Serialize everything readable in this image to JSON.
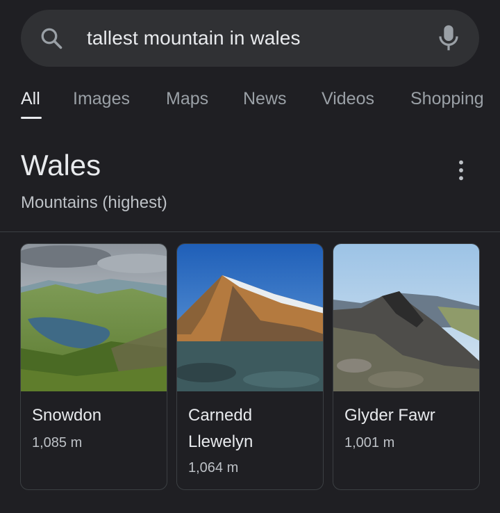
{
  "search": {
    "query": "tallest mountain in wales",
    "icon": "search-icon",
    "mic_icon": "mic-icon"
  },
  "tabs": [
    {
      "label": "All",
      "active": true
    },
    {
      "label": "Images",
      "active": false
    },
    {
      "label": "Maps",
      "active": false
    },
    {
      "label": "News",
      "active": false
    },
    {
      "label": "Videos",
      "active": false
    },
    {
      "label": "Shopping",
      "active": false
    }
  ],
  "entity": {
    "title": "Wales",
    "subtitle": "Mountains (highest)",
    "more_icon": "more-vert-icon"
  },
  "mountains": [
    {
      "name": "Snowdon",
      "height": "1,085 m"
    },
    {
      "name": "Carnedd Llewelyn",
      "height": "1,064 m"
    },
    {
      "name": "Glyder Fawr",
      "height": "1,001 m"
    }
  ],
  "colors": {
    "background": "#1f1f23",
    "search_bg": "#303134",
    "text_primary": "#e8eaed",
    "text_secondary": "#bdc1c6",
    "tab_inactive": "#9aa0a6"
  }
}
